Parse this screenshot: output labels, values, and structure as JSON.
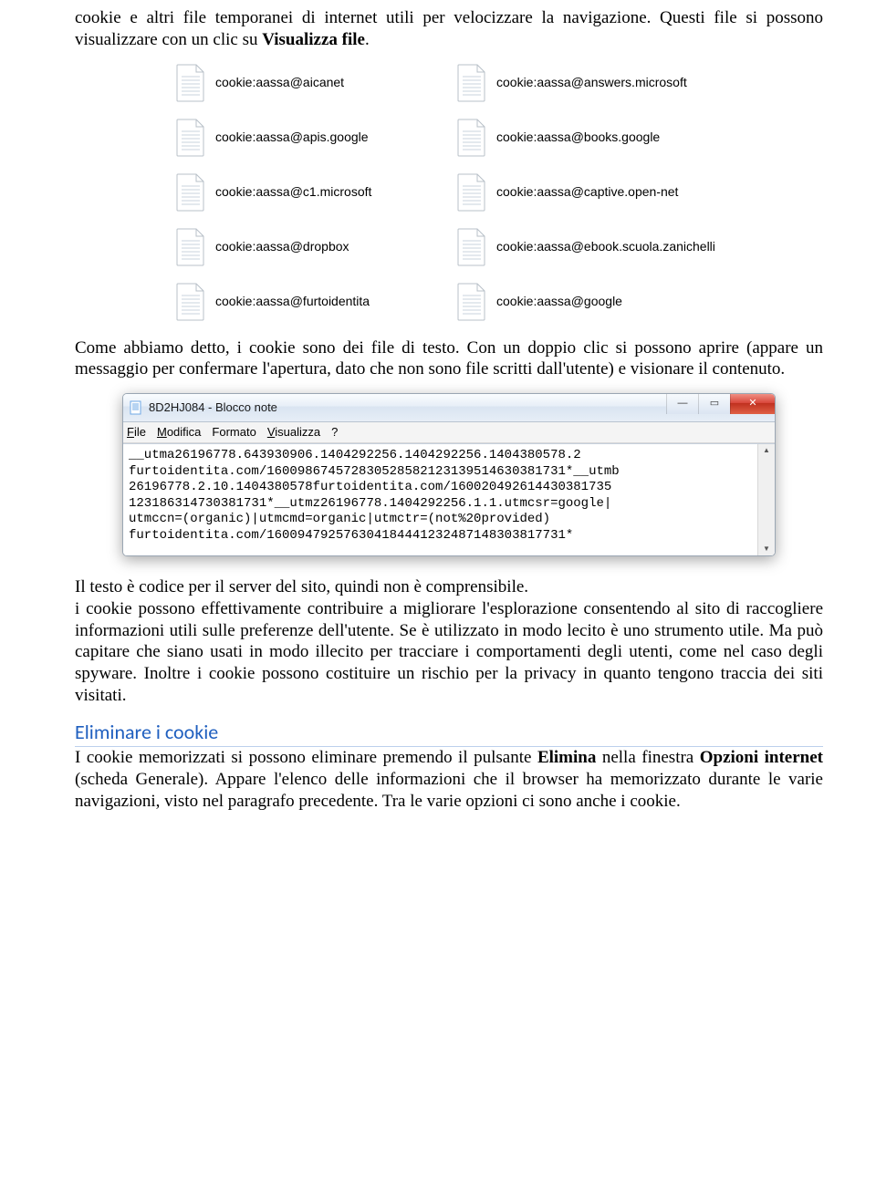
{
  "intro": {
    "part1": "cookie e altri file temporanei di internet utili per velocizzare la navigazione. Questi file si possono visualizzare con un clic su ",
    "bold1": "Visualizza file",
    "part2": "."
  },
  "files": {
    "left": [
      "cookie:aassa@aicanet",
      "cookie:aassa@apis.google",
      "cookie:aassa@c1.microsoft",
      "cookie:aassa@dropbox",
      "cookie:aassa@furtoidentita"
    ],
    "right": [
      "cookie:aassa@answers.microsoft",
      "cookie:aassa@books.google",
      "cookie:aassa@captive.open-net",
      "cookie:aassa@ebook.scuola.zanichelli",
      "cookie:aassa@google"
    ]
  },
  "para2": "Come abbiamo detto, i cookie sono dei file di testo. Con un doppio clic si possono aprire (appare un messaggio per confermare l'apertura, dato che non sono file scritti dall'utente) e visionare il contenuto.",
  "notepad": {
    "title": "8D2HJ084 - Blocco note",
    "menu": {
      "file": "File",
      "modifica": "Modifica",
      "formato": "Formato",
      "visualizza": "Visualizza",
      "help": "?"
    },
    "content": "__utma26196778.643930906.1404292256.1404292256.1404380578.2\nfurtoidentita.com/160098674572830528582123139514630381731*__utmb\n26196778.2.10.1404380578furtoidentita.com/160020492614430381735\n123186314730381731*__utmz26196778.1404292256.1.1.utmcsr=google|\nutmccn=(organic)|utmcmd=organic|utmctr=(not%20provided)\nfurtoidentita.com/160094792576304184441232487148303817731*"
  },
  "para3": "Il testo è codice per il server del sito, quindi non è comprensibile.\ni cookie possono effettivamente contribuire a migliorare l'esplorazione consentendo al sito di raccogliere informazioni utili sulle preferenze dell'utente. Se è utilizzato in modo lecito è uno strumento utile. Ma può capitare che siano usati in modo illecito per tracciare i comportamenti degli utenti, come nel caso degli spyware. Inoltre i cookie possono costituire un rischio per la privacy in quanto tengono traccia dei siti visitati.",
  "heading": "Eliminare i cookie",
  "para4": {
    "part1": "I cookie memorizzati si possono eliminare premendo il pulsante ",
    "bold1": "Elimina",
    "part2": " nella finestra ",
    "bold2": "Opzioni internet",
    "part3": " (scheda Generale). Appare l'elenco delle informazioni che il browser ha memorizzato durante le varie navigazioni, visto nel paragrafo precedente. Tra le varie opzioni ci sono anche i cookie."
  }
}
